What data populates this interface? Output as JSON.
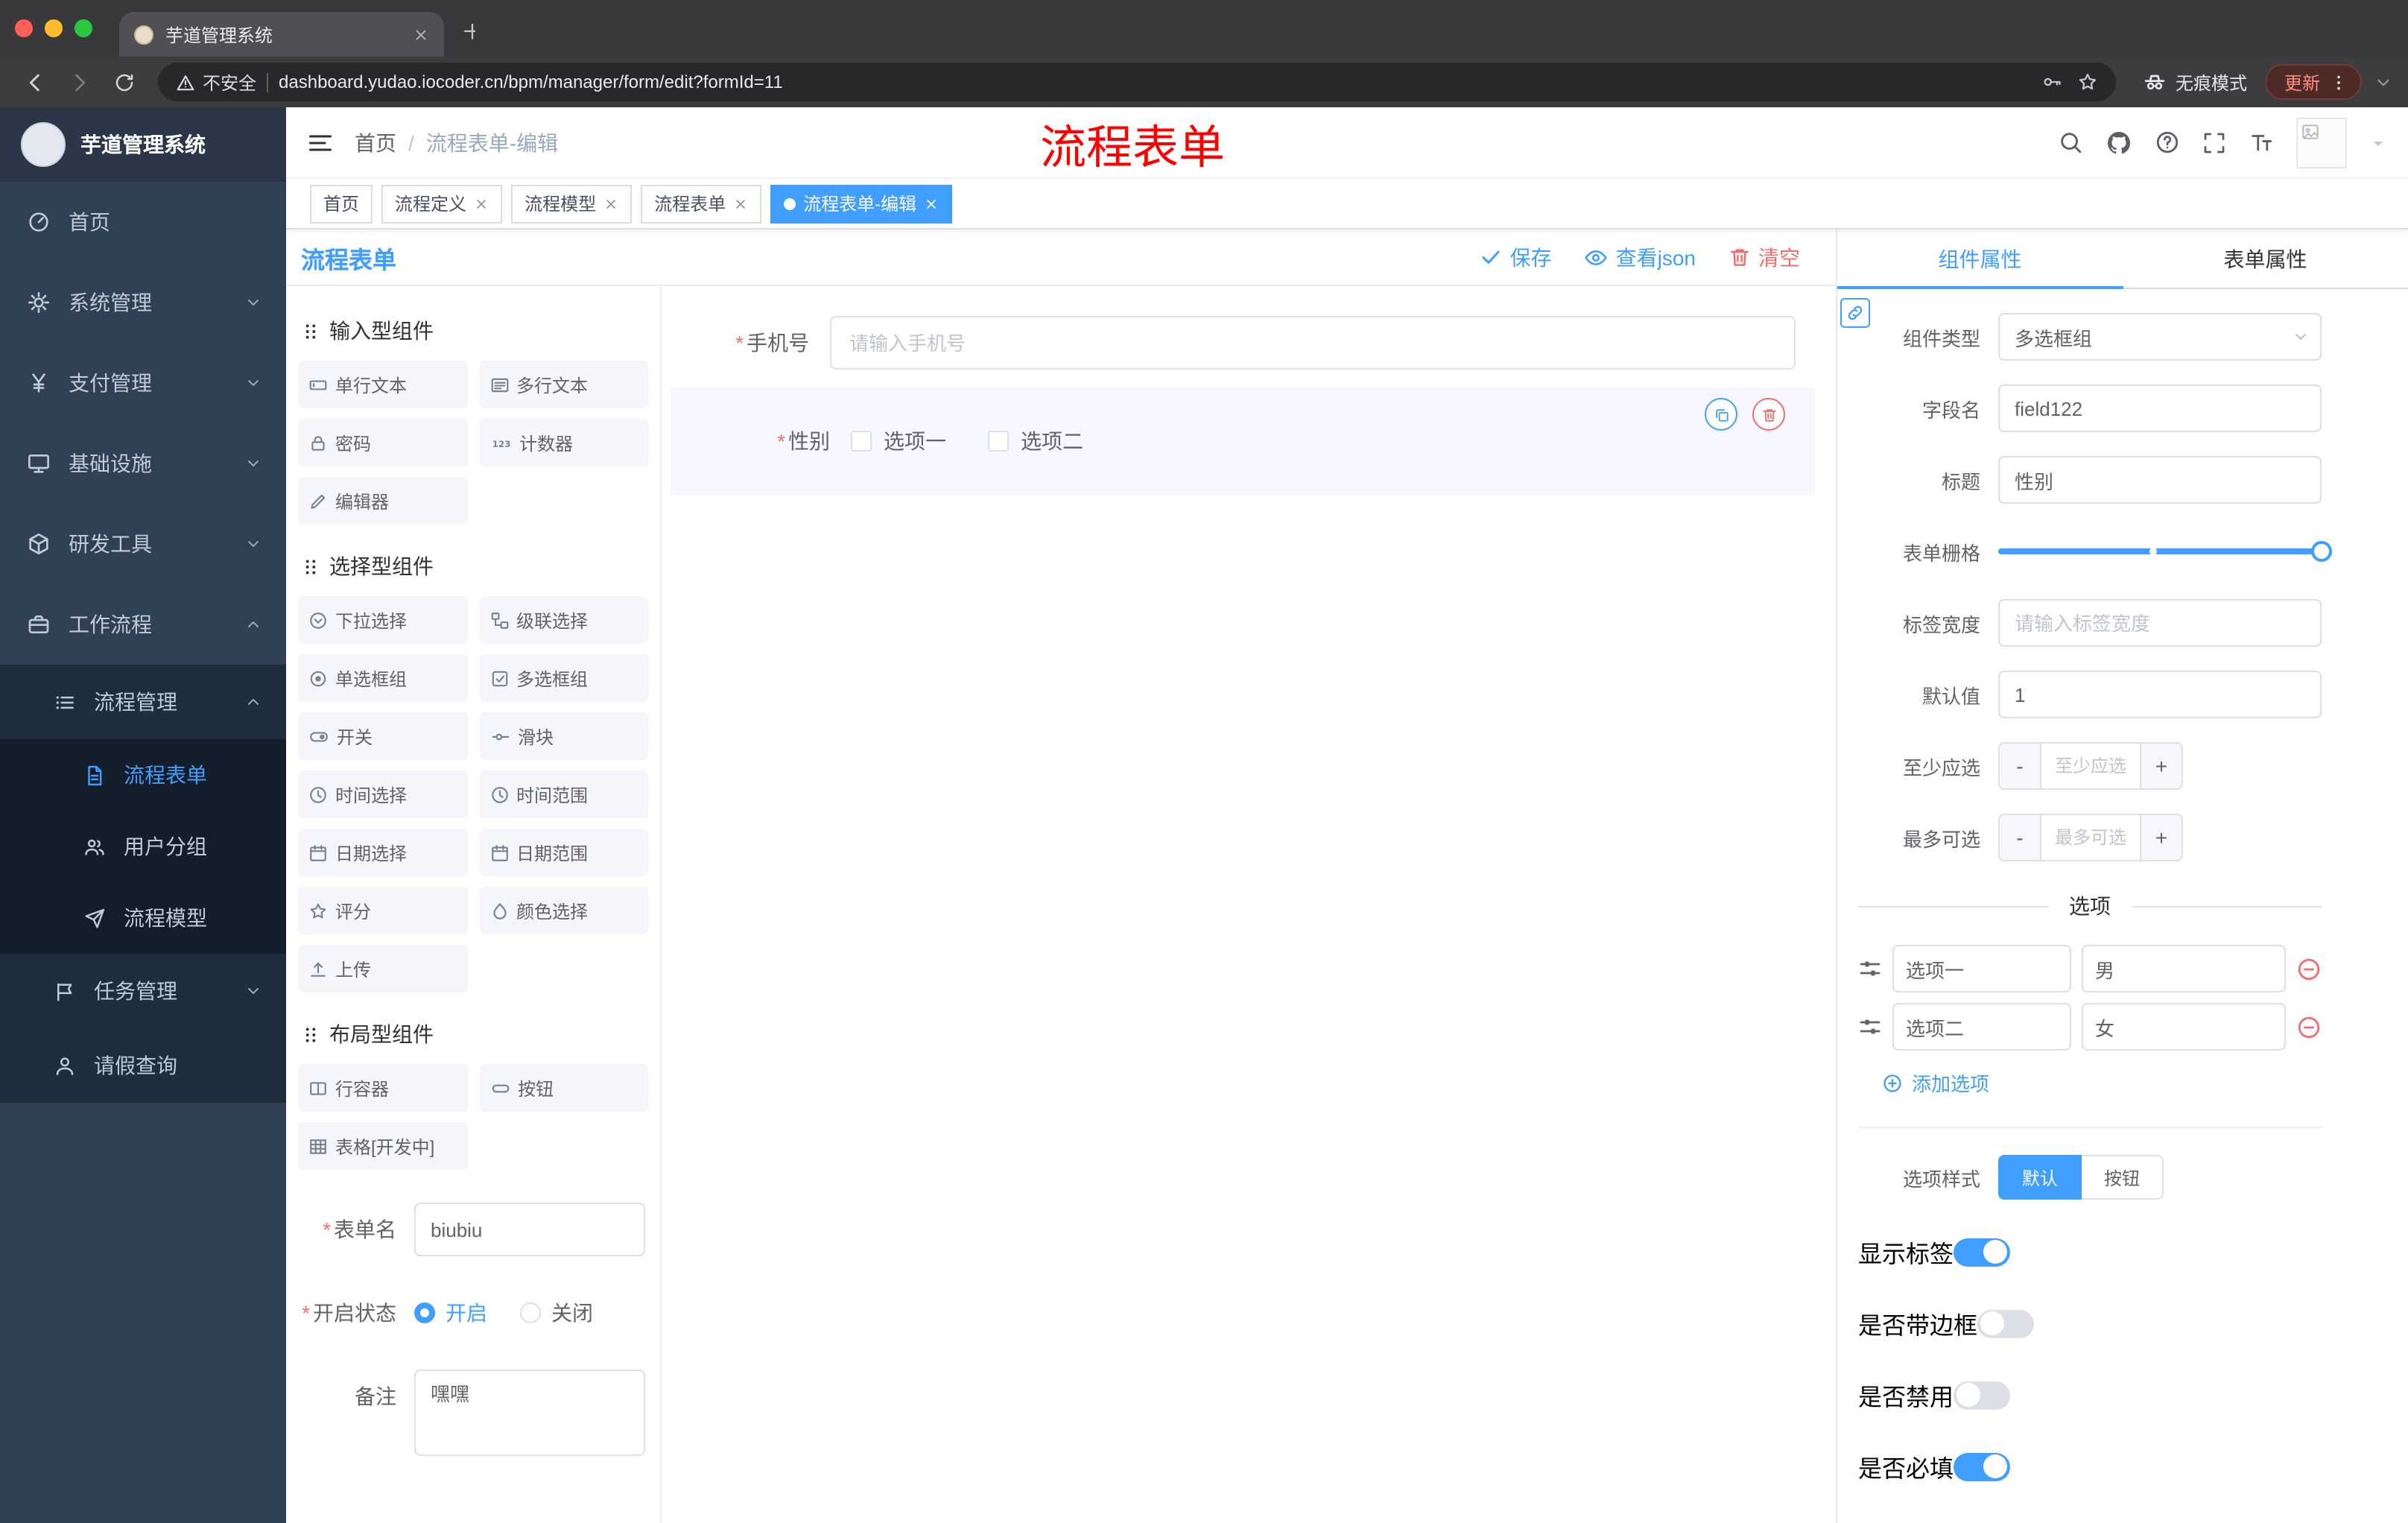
{
  "ui": {
    "required_mark": "*",
    "separator": "/",
    "plus": "+",
    "minus": "-"
  },
  "colors": {
    "primary": "#409eff",
    "danger": "#f56c6c",
    "annotation_red": "#ff0000",
    "sidebar_bg": "#304156",
    "active_tag_bg": "#409eff"
  },
  "browser": {
    "tab_title": "芋道管理系统",
    "security_label": "不安全",
    "url": "dashboard.yudao.iocoder.cn/bpm/manager/form/edit?formId=11",
    "incognito_label": "无痕模式",
    "update_label": "更新"
  },
  "sidebar": {
    "logo_title": "芋道管理系统",
    "home": "首页",
    "system": "系统管理",
    "payment": "支付管理",
    "infra": "基础设施",
    "devtools": "研发工具",
    "workflow": "工作流程",
    "process_mgmt": "流程管理",
    "process_form": "流程表单",
    "user_group": "用户分组",
    "process_model": "流程模型",
    "task_mgmt": "任务管理",
    "leave_query": "请假查询"
  },
  "header": {
    "breadcrumb_home": "首页",
    "breadcrumb_current": "流程表单-编辑",
    "annotation": "流程表单"
  },
  "tags": {
    "home": "首页",
    "t1": "流程定义",
    "t2": "流程模型",
    "t3": "流程表单",
    "active": "流程表单-编辑"
  },
  "palette": {
    "title": "流程表单",
    "group_input": "输入型组件",
    "group_select": "选择型组件",
    "group_layout": "布局型组件",
    "input_items": [
      "单行文本",
      "多行文本",
      "密码",
      "计数器",
      "编辑器"
    ],
    "select_items": [
      "下拉选择",
      "级联选择",
      "单选框组",
      "多选框组",
      "开关",
      "滑块",
      "时间选择",
      "时间范围",
      "日期选择",
      "日期范围",
      "评分",
      "颜色选择",
      "上传"
    ],
    "layout_items": [
      "行容器",
      "按钮",
      "表格[开发中]"
    ],
    "form": {
      "name_label": "表单名",
      "name_value": "biubiu",
      "status_label": "开启状态",
      "status_on": "开启",
      "status_off": "关闭",
      "remark_label": "备注",
      "remark_value": "嘿嘿"
    }
  },
  "canvas": {
    "save": "保存",
    "view_json": "查看json",
    "clear": "清空",
    "phone_label": "手机号",
    "phone_placeholder": "请输入手机号",
    "gender_label": "性别",
    "gender_opt1": "选项一",
    "gender_opt2": "选项二"
  },
  "props": {
    "tab_component": "组件属性",
    "tab_form": "表单属性",
    "type_label": "组件类型",
    "type_value": "多选框组",
    "field_label": "字段名",
    "field_value": "field122",
    "title_label": "标题",
    "title_value": "性别",
    "grid_label": "表单栅格",
    "label_width_label": "标签宽度",
    "label_width_placeholder": "请输入标签宽度",
    "default_label": "默认值",
    "default_value": "1",
    "min_label": "至少应选",
    "min_placeholder": "至少应选",
    "max_label": "最多可选",
    "max_placeholder": "最多可选",
    "options_title": "选项",
    "option_rows": [
      {
        "name": "选项一",
        "value": "男"
      },
      {
        "name": "选项二",
        "value": "女"
      }
    ],
    "add_option": "添加选项",
    "style_label": "选项样式",
    "style_default": "默认",
    "style_button": "按钮",
    "toggle_show_label": "显示标签",
    "toggle_border_label": "是否带边框",
    "toggle_disabled_label": "是否禁用",
    "toggle_required_label": "是否必填"
  }
}
